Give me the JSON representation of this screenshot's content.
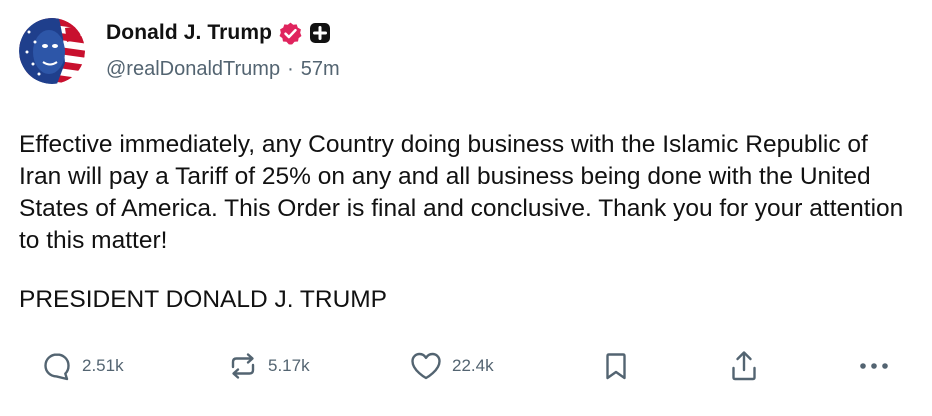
{
  "author": {
    "display_name": "Donald J. Trump",
    "handle": "@realDonaldTrump",
    "separator": "·",
    "time_ago": "57m",
    "avatar_icon": "avatar-flag-portrait",
    "verified_icon": "verified-badge-icon",
    "verified_color": "#e0245e",
    "plus_icon": "plus-badge-icon"
  },
  "post": {
    "body": "Effective immediately, any Country doing business with the Islamic Republic of Iran will pay a Tariff of 25% on any and all business being done with the United States of America. This Order is final and conclusive. Thank you for your attention to this matter!",
    "signature": "PRESIDENT DONALD J. TRUMP"
  },
  "actions": {
    "reply": {
      "icon": "reply-icon",
      "count": "2.51k"
    },
    "repost": {
      "icon": "repost-icon",
      "count": "5.17k"
    },
    "like": {
      "icon": "heart-icon",
      "count": "22.4k"
    },
    "bookmark": {
      "icon": "bookmark-icon"
    },
    "share": {
      "icon": "share-icon"
    },
    "more": {
      "icon": "more-icon"
    }
  },
  "colors": {
    "text": "#111111",
    "secondary": "#536471",
    "flag_red": "#c8102e",
    "flag_blue": "#1f3f8c"
  }
}
